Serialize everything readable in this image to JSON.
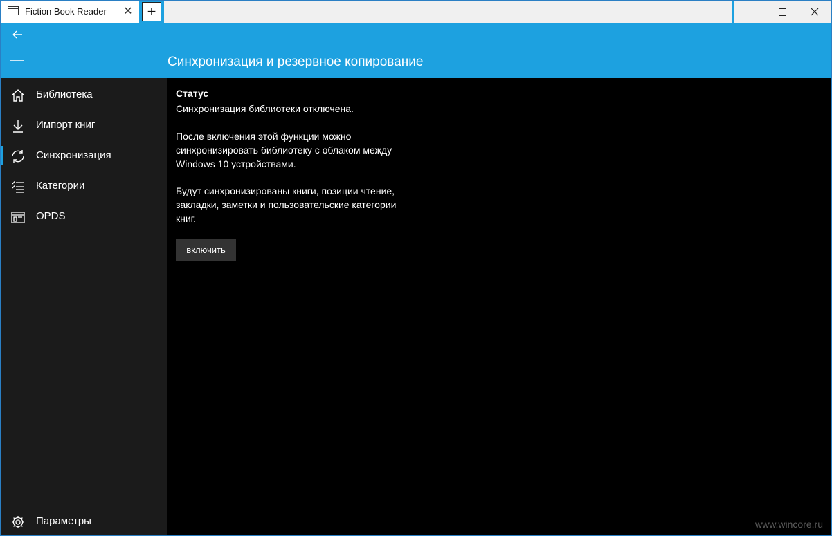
{
  "window": {
    "tab_title": "Fiction Book Reader",
    "new_tab": "+",
    "tab_close": "✕"
  },
  "header": {
    "title": "Синхронизация и резервное копирование"
  },
  "sidebar": {
    "items": [
      {
        "label": "Библиотека",
        "icon": "home-icon"
      },
      {
        "label": "Импорт книг",
        "icon": "download-icon"
      },
      {
        "label": "Синхронизация",
        "icon": "sync-icon",
        "selected": true
      },
      {
        "label": "Категории",
        "icon": "checklist-icon"
      },
      {
        "label": "OPDS",
        "icon": "catalog-icon"
      }
    ],
    "settings_label": "Параметры"
  },
  "content": {
    "status_heading": "Статус",
    "status_text": "Синхронизация библиотеки отключена.",
    "description_1": "После включения этой функции можно синхронизировать библиотеку с облаком между Windows 10 устройствами.",
    "description_2": "Будут синхронизированы книги, позиции чтение, закладки, заметки и пользовательские категории книг.",
    "enable_button": "включить"
  },
  "watermark": "www.wincore.ru",
  "colors": {
    "accent": "#1da1e0",
    "sidebar_bg": "#1b1b1b",
    "content_bg": "#000000",
    "button_bg": "#333333"
  }
}
